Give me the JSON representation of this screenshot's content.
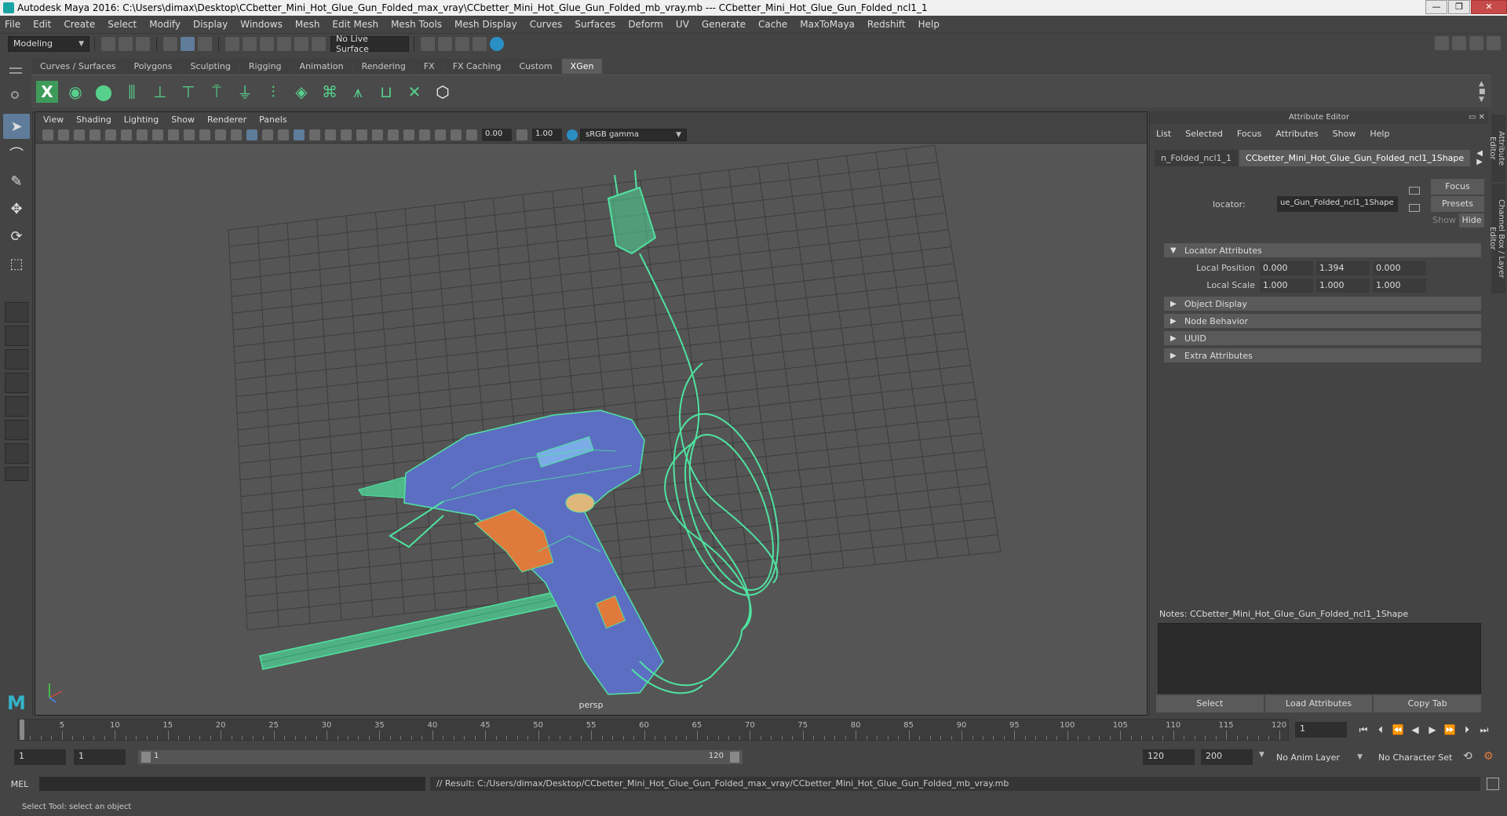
{
  "window": {
    "title": "Autodesk Maya 2016: C:\\Users\\dimax\\Desktop\\CCbetter_Mini_Hot_Glue_Gun_Folded_max_vray\\CCbetter_Mini_Hot_Glue_Gun_Folded_mb_vray.mb   ---   CCbetter_Mini_Hot_Glue_Gun_Folded_ncl1_1",
    "minimize": "—",
    "maximize": "❐",
    "close": "✕"
  },
  "menubar": [
    "File",
    "Edit",
    "Create",
    "Select",
    "Modify",
    "Display",
    "Windows",
    "Mesh",
    "Edit Mesh",
    "Mesh Tools",
    "Mesh Display",
    "Curves",
    "Surfaces",
    "Deform",
    "UV",
    "Generate",
    "Cache",
    "MaxToMaya",
    "Redshift",
    "Help"
  ],
  "status_line": {
    "mode": "Modeling",
    "live_surface": "No Live Surface"
  },
  "shelf": {
    "tabs": [
      "Curves / Surfaces",
      "Polygons",
      "Sculpting",
      "Rigging",
      "Animation",
      "Rendering",
      "FX",
      "FX Caching",
      "Custom",
      "XGen"
    ],
    "active_tab": "XGen"
  },
  "viewport": {
    "menu": [
      "View",
      "Shading",
      "Lighting",
      "Show",
      "Renderer",
      "Panels"
    ],
    "exposure": "0.00",
    "gamma": "1.00",
    "color_space": "sRGB gamma",
    "camera_label": "persp"
  },
  "attribute_editor": {
    "title": "Attribute Editor",
    "menu": [
      "List",
      "Selected",
      "Focus",
      "Attributes",
      "Show",
      "Help"
    ],
    "tabs": [
      "n_Folded_ncl1_1",
      "CCbetter_Mini_Hot_Glue_Gun_Folded_ncl1_1Shape"
    ],
    "locator_label": "locator:",
    "locator_value": "ue_Gun_Folded_ncl1_1Shape",
    "focus_btn": "Focus",
    "presets_btn": "Presets",
    "show_btn": "Show",
    "hide_btn": "Hide",
    "sections": {
      "locator_attributes": "Locator Attributes",
      "object_display": "Object Display",
      "node_behavior": "Node Behavior",
      "uuid": "UUID",
      "extra_attributes": "Extra Attributes"
    },
    "local_position": {
      "label": "Local Position",
      "x": "0.000",
      "y": "1.394",
      "z": "0.000"
    },
    "local_scale": {
      "label": "Local Scale",
      "x": "1.000",
      "y": "1.000",
      "z": "1.000"
    },
    "notes": "Notes:  CCbetter_Mini_Hot_Glue_Gun_Folded_ncl1_1Shape",
    "bottom_buttons": {
      "select": "Select",
      "load": "Load Attributes",
      "copy": "Copy Tab"
    },
    "side_tabs": [
      "Attribute Editor",
      "Channel Box / Layer Editor"
    ]
  },
  "time_slider": {
    "ticks": [
      "5",
      "10",
      "15",
      "20",
      "25",
      "30",
      "35",
      "40",
      "45",
      "50",
      "55",
      "60",
      "65",
      "70",
      "75",
      "80",
      "85",
      "90",
      "95",
      "100",
      "105",
      "110",
      "115",
      "120"
    ],
    "start_label": "1",
    "current_frame": "1"
  },
  "range": {
    "start": "1",
    "playback_start": "1",
    "slider_start": "1",
    "slider_end": "120",
    "playback_end": "120",
    "end": "200",
    "anim_layer": "No Anim Layer",
    "character_set": "No Character Set"
  },
  "command_line": {
    "language": "MEL",
    "result": "// Result: C:/Users/dimax/Desktop/CCbetter_Mini_Hot_Glue_Gun_Folded_max_vray/CCbetter_Mini_Hot_Glue_Gun_Folded_mb_vray.mb"
  },
  "help_line": "Select Tool: select an object",
  "colors": {
    "wireframe": "#4fe3a0",
    "gun_body": "#5c6ec2",
    "trigger": "#e07a3c",
    "grid": "#3e3e3e",
    "active_tab": "#5d5d5d"
  }
}
